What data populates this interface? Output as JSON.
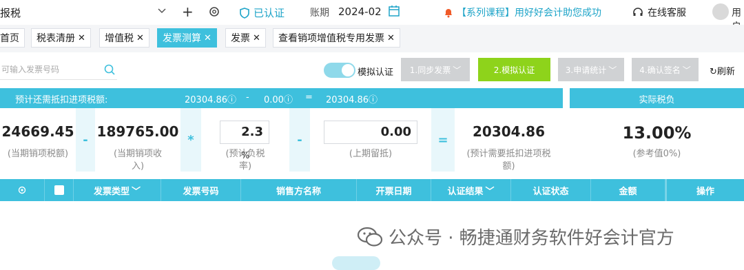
{
  "topbar": {
    "org_name": "报税",
    "verified_label": "已认证",
    "period_label": "账期",
    "period_value": "2024-02",
    "promo_text": "【系列课程】用好好会计助您成功",
    "service_label": "在线客服",
    "user_label": "用户"
  },
  "tabs": [
    {
      "label": "首页",
      "closable": false
    },
    {
      "label": "税表清册",
      "closable": true
    },
    {
      "label": "增值税",
      "closable": true
    },
    {
      "label": "发票测算",
      "closable": true,
      "active": true
    },
    {
      "label": "发票",
      "closable": true
    },
    {
      "label": "查看销项增值税专用发票",
      "closable": true
    }
  ],
  "toolbar": {
    "search_placeholder": "可输入发票号码",
    "toggle_label": "模拟认证",
    "toggle_on": true,
    "steps": [
      "1.同步发票",
      "2.模拟认证",
      "3.申请统计",
      "4.确认签名"
    ],
    "current_step": 2,
    "refresh_label": "刷新"
  },
  "summary": {
    "label": "预计还需抵扣进项税额:",
    "value1": "20304.86",
    "minus": "-",
    "value2": "0.00",
    "equals": "=",
    "result": "20304.86",
    "actual_tax_label": "实际税负"
  },
  "calc": {
    "output_tax": "24669.45",
    "output_tax_label": "(当期销项税额)",
    "op1": "-",
    "sales_income": "189765.00",
    "sales_income_label": "(当期销项收入)",
    "op2": "*",
    "est_rate": "2.3",
    "est_rate_label": "(预计负税率)",
    "percent": "%",
    "op3": "-",
    "prev_retained": "0.00",
    "prev_retained_label": "(上期留抵)",
    "op4": "=",
    "needed": "20304.86",
    "needed_label": "(预计需要抵扣进项税额)",
    "actual_rate": "13.00%",
    "reference_label": "(参考值0%)"
  },
  "grid": {
    "columns": [
      "发票类型",
      "发票号码",
      "销售方名称",
      "开票日期",
      "认证结果",
      "认证状态",
      "金额",
      "操作"
    ]
  },
  "watermark": "公众号 · 畅捷通财务软件好会计官方",
  "colors": {
    "accent": "#3ec0dd",
    "current_step": "#8ed31b",
    "disabled_step": "#d0d2d4",
    "promo": "#1ea4c8"
  }
}
